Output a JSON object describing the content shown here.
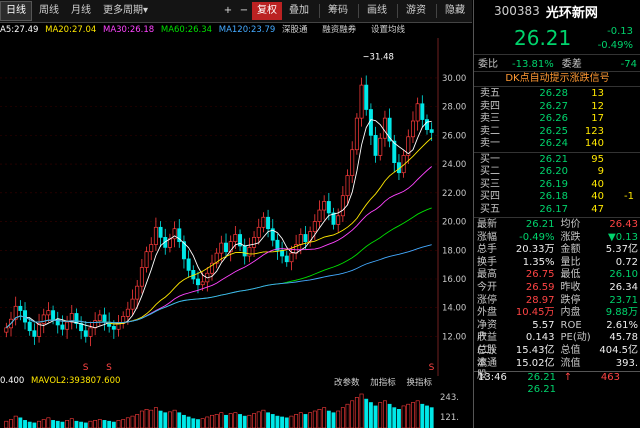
{
  "toolbar": {
    "tabs": [
      "日线",
      "周线",
      "月线",
      "更多周期"
    ],
    "more_arrow": "▾",
    "plus": "+",
    "minus": "−",
    "fuquan": "复权",
    "items": [
      "叠加",
      "筹码",
      "画线",
      "游资",
      "隐藏"
    ]
  },
  "ma": {
    "ma5": "A5:27.49",
    "ma20": "MA20:27.04",
    "ma30": "MA30:26.18",
    "ma60": "MA60:26.34",
    "ma120": "MA120:23.79",
    "shgt": "深股通",
    "rzrq": "融资融券",
    "setting": "设置均线"
  },
  "chart_labels": {
    "high_marker": "31.48",
    "y_ticks": [
      "30.00",
      "28.00",
      "26.00",
      "24.00",
      "22.00",
      "20.00",
      "18.00",
      "16.00",
      "14.00",
      "12.00"
    ],
    "s_marker": "S"
  },
  "volume": {
    "prefix": "0.400",
    "mavol": "MAVOL2:393807.600",
    "btn1": "改参数",
    "btn2": "加指标",
    "btn3": "换指标",
    "y_ticks": [
      "243.",
      "121."
    ]
  },
  "quote": {
    "code": "300383",
    "name": "光环新网",
    "price": "26.21",
    "change": "-0.13",
    "pct": "-0.49%",
    "weibi_label": "委比",
    "weibi": "-13.81%",
    "weicha_label": "委差",
    "weicha": "-74",
    "dk_banner": "DK点自动提示涨跌信号"
  },
  "orderbook": {
    "sells": [
      {
        "label": "卖五",
        "price": "26.28",
        "vol": "13",
        "extra": ""
      },
      {
        "label": "卖四",
        "price": "26.27",
        "vol": "12",
        "extra": ""
      },
      {
        "label": "卖三",
        "price": "26.26",
        "vol": "17",
        "extra": ""
      },
      {
        "label": "卖二",
        "price": "26.25",
        "vol": "123",
        "extra": ""
      },
      {
        "label": "卖一",
        "price": "26.24",
        "vol": "140",
        "extra": ""
      }
    ],
    "buys": [
      {
        "label": "买一",
        "price": "26.21",
        "vol": "95",
        "extra": ""
      },
      {
        "label": "买二",
        "price": "26.20",
        "vol": "9",
        "extra": ""
      },
      {
        "label": "买三",
        "price": "26.19",
        "vol": "40",
        "extra": ""
      },
      {
        "label": "买四",
        "price": "26.18",
        "vol": "40",
        "extra": "-1"
      },
      {
        "label": "买五",
        "price": "26.17",
        "vol": "47",
        "extra": ""
      }
    ]
  },
  "stats": [
    {
      "l1": "最新",
      "v1": "26.21",
      "c1": "green",
      "l2": "均价",
      "v2": "26.43",
      "c2": "red"
    },
    {
      "l1": "涨幅",
      "v1": "-0.49%",
      "c1": "green",
      "l2": "涨跌",
      "v2": "▼0.13",
      "c2": "green"
    },
    {
      "l1": "总手",
      "v1": "20.33万",
      "c1": "white",
      "l2": "金额",
      "v2": "5.37亿",
      "c2": "white"
    },
    {
      "l1": "换手",
      "v1": "1.35%",
      "c1": "white",
      "l2": "量比",
      "v2": "0.72",
      "c2": "white"
    },
    {
      "l1": "最高",
      "v1": "26.75",
      "c1": "red",
      "l2": "最低",
      "v2": "26.10",
      "c2": "green"
    },
    {
      "l1": "今开",
      "v1": "26.59",
      "c1": "red",
      "l2": "昨收",
      "v2": "26.34",
      "c2": "white"
    },
    {
      "l1": "涨停",
      "v1": "28.97",
      "c1": "red",
      "l2": "跌停",
      "v2": "23.71",
      "c2": "green"
    },
    {
      "l1": "外盘",
      "v1": "10.45万",
      "c1": "red",
      "l2": "内盘",
      "v2": "9.88万",
      "c2": "green"
    },
    {
      "l1": "净资产",
      "v1": "5.57",
      "c1": "white",
      "l2": "ROE",
      "v2": "2.61%",
      "c2": "white"
    },
    {
      "l1": "收益(二)",
      "v1": "0.143",
      "c1": "white",
      "l2": "PE(动)",
      "v2": "45.78",
      "c2": "white"
    },
    {
      "l1": "总股本",
      "v1": "15.43亿",
      "c1": "white",
      "l2": "总值",
      "v2": "404.5亿",
      "c2": "white"
    },
    {
      "l1": "流通股",
      "v1": "15.02亿",
      "c1": "white",
      "l2": "流值",
      "v2": "393.",
      "c2": "white"
    }
  ],
  "ticks": [
    {
      "time": "13:46",
      "price": "26.21",
      "arrow": "↑",
      "vol": "463"
    },
    {
      "time": "",
      "price": "26.21",
      "arrow": "",
      "vol": ""
    }
  ],
  "chart_data": {
    "type": "candlestick",
    "ylim": [
      10.5,
      32.5
    ],
    "y_ticks": [
      12,
      14,
      16,
      18,
      20,
      22,
      24,
      26,
      28,
      30
    ],
    "close_series": [
      12.6,
      13.2,
      14.1,
      13.8,
      13.0,
      12.4,
      12.0,
      12.9,
      13.5,
      13.8,
      13.2,
      12.8,
      12.5,
      13.0,
      13.6,
      12.9,
      12.4,
      12.0,
      12.6,
      13.1,
      13.5,
      13.0,
      12.7,
      12.5,
      12.9,
      13.4,
      13.9,
      14.6,
      15.5,
      16.8,
      17.9,
      18.4,
      19.6,
      18.9,
      18.2,
      18.8,
      19.5,
      18.6,
      17.4,
      16.6,
      16.0,
      15.6,
      15.8,
      16.4,
      17.1,
      17.8,
      18.5,
      17.9,
      18.6,
      19.1,
      18.3,
      17.6,
      18.2,
      18.9,
      19.6,
      20.3,
      19.5,
      18.7,
      18.0,
      17.6,
      17.2,
      17.8,
      18.4,
      19.1,
      18.6,
      19.3,
      20.0,
      20.8,
      21.4,
      20.6,
      19.8,
      20.4,
      21.8,
      23.2,
      25.0,
      27.2,
      29.5,
      27.8,
      26.0,
      24.6,
      25.8,
      27.2,
      25.6,
      24.1,
      23.4,
      24.6,
      25.9,
      27.0,
      28.2,
      27.1,
      26.4,
      26.2
    ],
    "vol_spikes": [
      8,
      10,
      14,
      12,
      9,
      7,
      6,
      8,
      10,
      12,
      9,
      8,
      7,
      9,
      11,
      8,
      7,
      6,
      8,
      9,
      10,
      9,
      8,
      7,
      9,
      10,
      12,
      14,
      16,
      20,
      22,
      21,
      24,
      20,
      18,
      19,
      21,
      18,
      15,
      13,
      11,
      10,
      11,
      13,
      15,
      16,
      18,
      15,
      17,
      18,
      16,
      14,
      15,
      17,
      19,
      21,
      18,
      16,
      14,
      13,
      12,
      14,
      16,
      18,
      16,
      18,
      20,
      22,
      24,
      20,
      18,
      20,
      24,
      28,
      32,
      36,
      40,
      34,
      30,
      26,
      30,
      32,
      28,
      24,
      22,
      26,
      28,
      30,
      32,
      28,
      26,
      24
    ]
  }
}
